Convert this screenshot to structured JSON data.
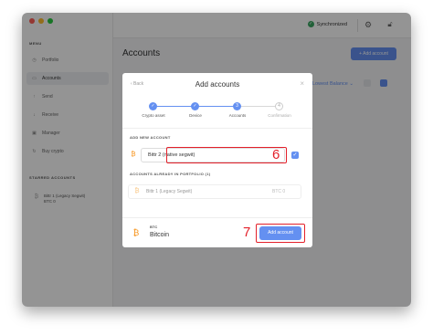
{
  "window": {
    "dot_colors": [
      "#ff5f57",
      "#febc2e",
      "#28c840"
    ]
  },
  "sidebar": {
    "menu_label": "MENU",
    "items": [
      {
        "label": "Portfolio",
        "icon": "clock-icon"
      },
      {
        "label": "Accounts",
        "icon": "wallet-icon",
        "active": true
      },
      {
        "label": "Send",
        "icon": "send-icon"
      },
      {
        "label": "Receive",
        "icon": "receive-icon"
      },
      {
        "label": "Manager",
        "icon": "manager-icon"
      },
      {
        "label": "Buy crypto",
        "icon": "refresh-icon"
      }
    ],
    "starred_label": "STARRED ACCOUNTS",
    "starred": [
      {
        "name": "Bittr 1 (Legacy Segwit)",
        "balance": "BTC 0"
      }
    ]
  },
  "topbar": {
    "sync_text": "Synchronized"
  },
  "main": {
    "title": "Accounts",
    "add_button": "+ Add account",
    "sort_text": "Lowest Balance ⌄"
  },
  "modal": {
    "back": "‹ Back",
    "title": "Add accounts",
    "close": "×",
    "steps": [
      {
        "label": "Crypto asset",
        "state": "done"
      },
      {
        "label": "Device",
        "state": "done"
      },
      {
        "label": "Accounts",
        "state": "current",
        "number": "3"
      },
      {
        "label": "Confirmation",
        "state": "todo",
        "number": "4"
      }
    ],
    "new_section": "ADD NEW ACCOUNT",
    "new_account_name": "Bittr 2 (native segwit)",
    "existing_section": "ACCOUNTS ALREADY IN PORTFOLIO (1)",
    "existing": [
      {
        "name": "Bittr 1 (Legacy Segwit)",
        "balance": "BTC 0"
      }
    ],
    "footer": {
      "ticker": "BTC",
      "name": "Bitcoin",
      "button": "Add account"
    }
  },
  "annotations": {
    "marker_6": "6",
    "marker_7": "7"
  },
  "colors": {
    "accent": "#6490f1",
    "annotation": "#e3202a",
    "bitcoin": "#f7931a",
    "sync": "#3aa661"
  }
}
